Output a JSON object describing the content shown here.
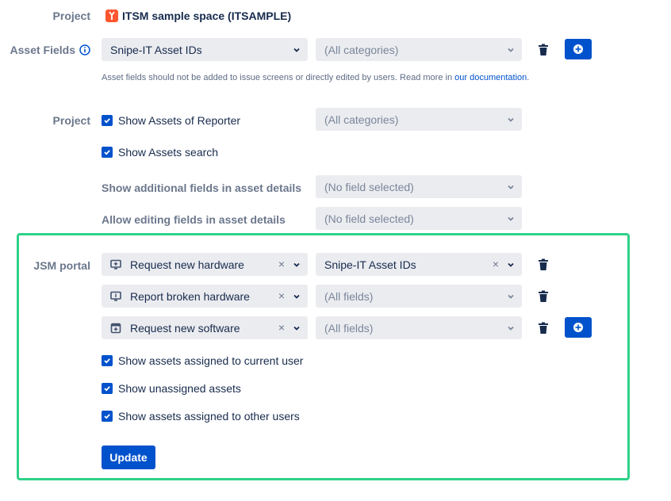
{
  "project": {
    "label": "Project",
    "name": "ITSM sample space (ITSAMPLE)"
  },
  "asset_fields": {
    "label": "Asset Fields",
    "field_select": "Snipe-IT Asset IDs",
    "category_select": "(All categories)",
    "hint_prefix": "Asset fields should not be added to issue screens or directly edited by users. Read more in ",
    "hint_link": "our documentation",
    "hint_suffix": "."
  },
  "project_section": {
    "label": "Project",
    "show_reporter_assets": "Show Assets of Reporter",
    "reporter_category_select": "(All categories)",
    "show_assets_search": "Show Assets search",
    "additional_fields_label": "Show additional fields in asset details",
    "additional_fields_select": "(No field selected)",
    "editing_fields_label": "Allow editing fields in asset details",
    "editing_fields_select": "(No field selected)"
  },
  "jsm_portal": {
    "label": "JSM portal",
    "rows": [
      {
        "request_type": "Request new hardware",
        "field": "Snipe-IT Asset IDs"
      },
      {
        "request_type": "Report broken hardware",
        "field": "(All fields)"
      },
      {
        "request_type": "Request new software",
        "field": "(All fields)"
      }
    ],
    "show_current_user": "Show assets assigned to current user",
    "show_unassigned": "Show unassigned assets",
    "show_other_users": "Show assets assigned to other users",
    "update_label": "Update"
  },
  "colors": {
    "primary": "#0052cc",
    "highlight_border": "#2ed289",
    "select_bg": "#ebecf0",
    "label": "#6b778c"
  },
  "icons": {
    "project": "project-avatar-icon",
    "info": "info-icon",
    "chevron": "chevron-down-icon",
    "clear": "clear-icon",
    "delete": "trash-icon",
    "add": "plus-circle-icon",
    "checkbox": "checkbox-checked-icon",
    "monitor": "monitor-icon",
    "software": "software-box-icon"
  }
}
